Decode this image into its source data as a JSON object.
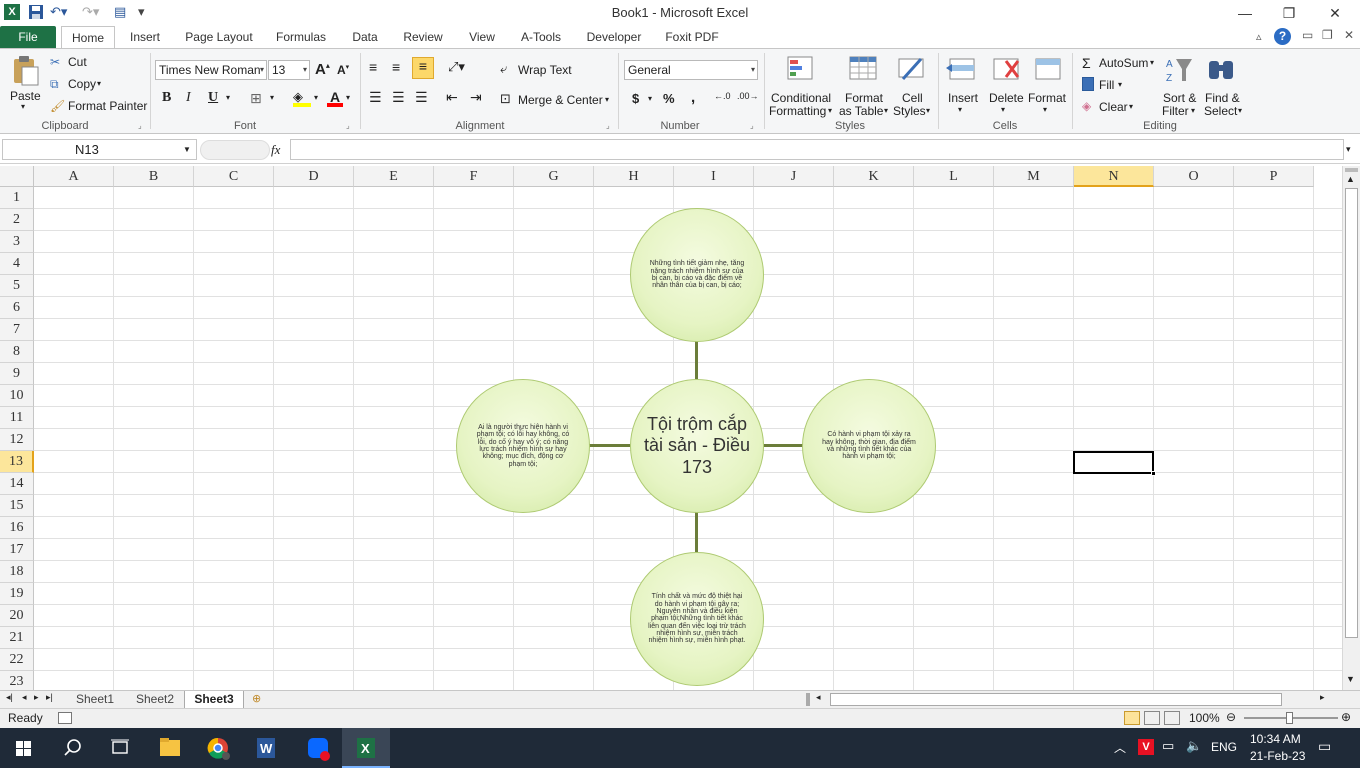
{
  "window": {
    "title": "Book1 - Microsoft Excel",
    "minimize": "—",
    "restore": "❐",
    "close": "✕"
  },
  "tabs": [
    "File",
    "Home",
    "Insert",
    "Page Layout",
    "Formulas",
    "Data",
    "Review",
    "View",
    "A-Tools",
    "Developer",
    "Foxit PDF"
  ],
  "ribbon": {
    "clipboard": {
      "paste": "Paste",
      "cut": "Cut",
      "copy": "Copy",
      "format_painter": "Format Painter",
      "label": "Clipboard"
    },
    "font": {
      "font_name": "Times New Roman",
      "font_size": "13",
      "bold": "B",
      "italic": "I",
      "underline": "U",
      "label": "Font"
    },
    "alignment": {
      "wrap_text": "Wrap Text",
      "merge_center": "Merge & Center",
      "label": "Alignment"
    },
    "number": {
      "format": "General",
      "currency": "$",
      "percent": "%",
      "comma": ",",
      "label": "Number"
    },
    "styles": {
      "conditional": "Conditional",
      "conditional2": "Formatting",
      "format_table": "Format",
      "format_table2": "as Table",
      "cell_styles": "Cell",
      "cell_styles2": "Styles",
      "label": "Styles"
    },
    "cells": {
      "insert": "Insert",
      "delete": "Delete",
      "format": "Format",
      "label": "Cells"
    },
    "editing": {
      "autosum": "AutoSum",
      "fill": "Fill",
      "clear": "Clear",
      "sort": "Sort &",
      "sort2": "Filter",
      "find": "Find &",
      "find2": "Select",
      "label": "Editing"
    }
  },
  "formula_bar": {
    "name_box": "N13",
    "fx": "fx",
    "formula": ""
  },
  "grid": {
    "columns": [
      "A",
      "B",
      "C",
      "D",
      "E",
      "F",
      "G",
      "H",
      "I",
      "J",
      "K",
      "L",
      "M",
      "N",
      "O",
      "P"
    ],
    "rows": [
      "1",
      "2",
      "3",
      "4",
      "5",
      "6",
      "7",
      "8",
      "9",
      "10",
      "11",
      "12",
      "13",
      "14",
      "15",
      "16",
      "17",
      "18",
      "19",
      "20",
      "21",
      "22",
      "23"
    ],
    "selected_col": "N",
    "selected_row": "13"
  },
  "diagram": {
    "center": "Tội trộm cắp tài sản - Điều 173",
    "top": "Những tình tiết giảm nhẹ, tăng nặng trách nhiệm hình sự của bị can, bị cáo và đặc điểm về nhân thân của bị can, bị cáo;",
    "left": "Ai là người thực hiện hành vi phạm tội; có lỗi hay không, có lỗi, do cố ý hay vô ý; có năng lực trách nhiệm hình sự hay không; mục đích, động cơ phạm tội;",
    "right": "Có hành vi phạm tội xảy ra hay không, thời gian, địa điểm và những tình tiết khác của hành vi phạm tội;",
    "bottom": "Tính chất và mức độ thiệt hại do hành vi phạm tội gây ra; Nguyên nhân và điều kiện phạm tội;Những tình tiết khác liên quan đến việc loại trừ trách nhiệm hình sự, miễn trách nhiệm hình sự, miễn hình phạt."
  },
  "sheets": [
    "Sheet1",
    "Sheet2",
    "Sheet3"
  ],
  "active_sheet": "Sheet3",
  "status": {
    "ready": "Ready",
    "zoom": "100%"
  },
  "taskbar": {
    "lang": "ENG",
    "time": "10:34 AM",
    "date": "21-Feb-23"
  },
  "colors": {
    "excel_green": "#1e7145",
    "select_col": "#fce69b",
    "circle_fill": "#e6f4c4",
    "connector": "#6b7d3a"
  }
}
